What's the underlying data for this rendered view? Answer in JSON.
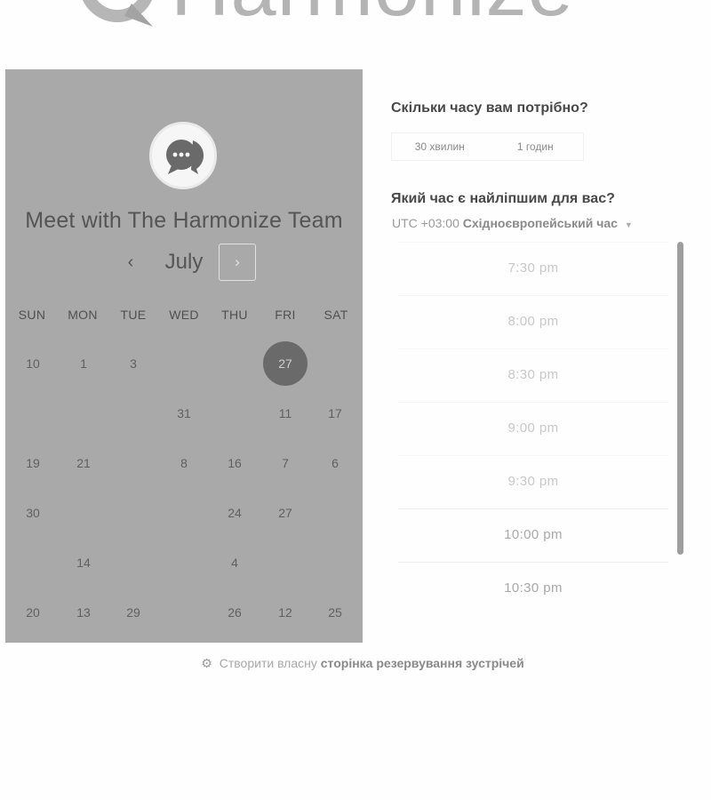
{
  "brand": {
    "name": "Harmonize",
    "logo_icon": "chat-bubble-logo-icon"
  },
  "calendar": {
    "title": "Meet with The Harmonize Team",
    "avatar_icon": "chat-bubble-ellipsis-icon",
    "prev_label": "‹",
    "month": "July",
    "next_label": "›",
    "weekdays": [
      "SUN",
      "MON",
      "TUE",
      "WED",
      "THU",
      "FRI",
      "SAT"
    ],
    "weeks": [
      [
        "10",
        "1",
        "3",
        "",
        "",
        "27",
        ""
      ],
      [
        "",
        "",
        "",
        "31",
        "",
        "11",
        "17"
      ],
      [
        "19",
        "21",
        "",
        "8",
        "16",
        "7",
        "6"
      ],
      [
        "30",
        "",
        "",
        "",
        "24",
        "27",
        ""
      ],
      [
        "",
        "14",
        "",
        "",
        "4",
        "",
        ""
      ],
      [
        "20",
        "13",
        "29",
        "",
        "26",
        "12",
        "25"
      ]
    ],
    "selected_day": "27"
  },
  "booking": {
    "duration_question": "Скільки часу вам потрібно?",
    "durations": [
      "30 хвилин",
      "1 годин"
    ],
    "time_question": "Який час є найліпшим для вас?",
    "timezone_offset": "UTC +03:00",
    "timezone_name": "Східноєвропейський час",
    "slots": [
      "7:30 pm",
      "8:00 pm",
      "8:30 pm",
      "9:00 pm",
      "9:30 pm",
      "10:00 pm",
      "10:30 pm"
    ]
  },
  "footer": {
    "icon": "sprocket-icon",
    "text": "Створити власну",
    "strong": "сторінка резервування зустрічей"
  }
}
